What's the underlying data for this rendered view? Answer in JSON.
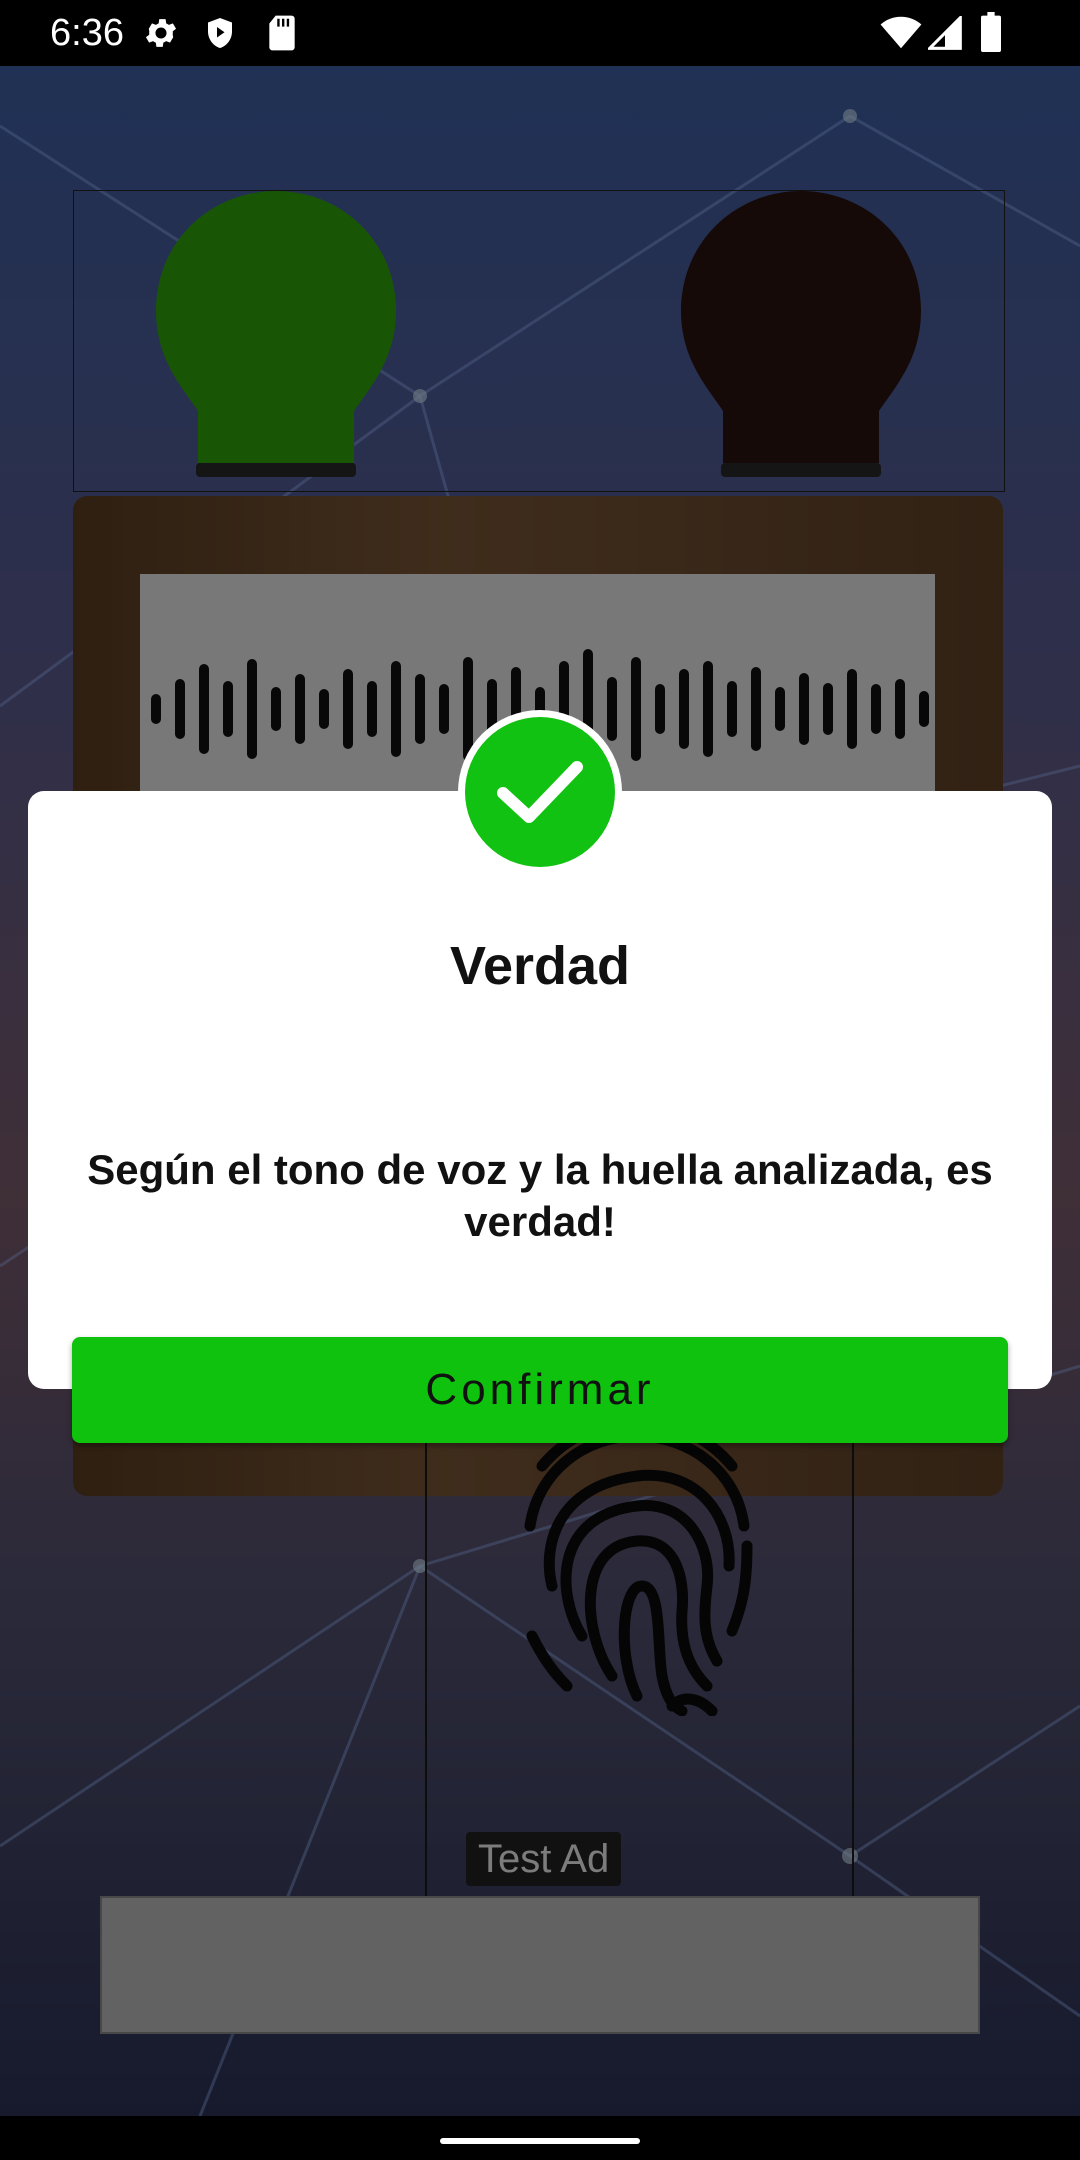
{
  "status_bar": {
    "time": "6:36",
    "left_icons": [
      "gear-icon",
      "shield-play-icon",
      "sd-card-icon"
    ],
    "right_icons": [
      "wifi-icon",
      "cell-signal-icon",
      "battery-icon"
    ]
  },
  "background": {
    "bulb_left_color": "#2fa60a",
    "bulb_right_color": "#2a1410",
    "fingerprint_icon": "fingerprint-icon",
    "ad_label": "Test Ad"
  },
  "dialog": {
    "icon": "check-circle-icon",
    "icon_color": "#12c212",
    "title": "Verdad",
    "message": "Según el tono de voz y la huella analizada, es verdad!",
    "confirm_label": "Confirmar",
    "confirm_color": "#0ec20e"
  }
}
